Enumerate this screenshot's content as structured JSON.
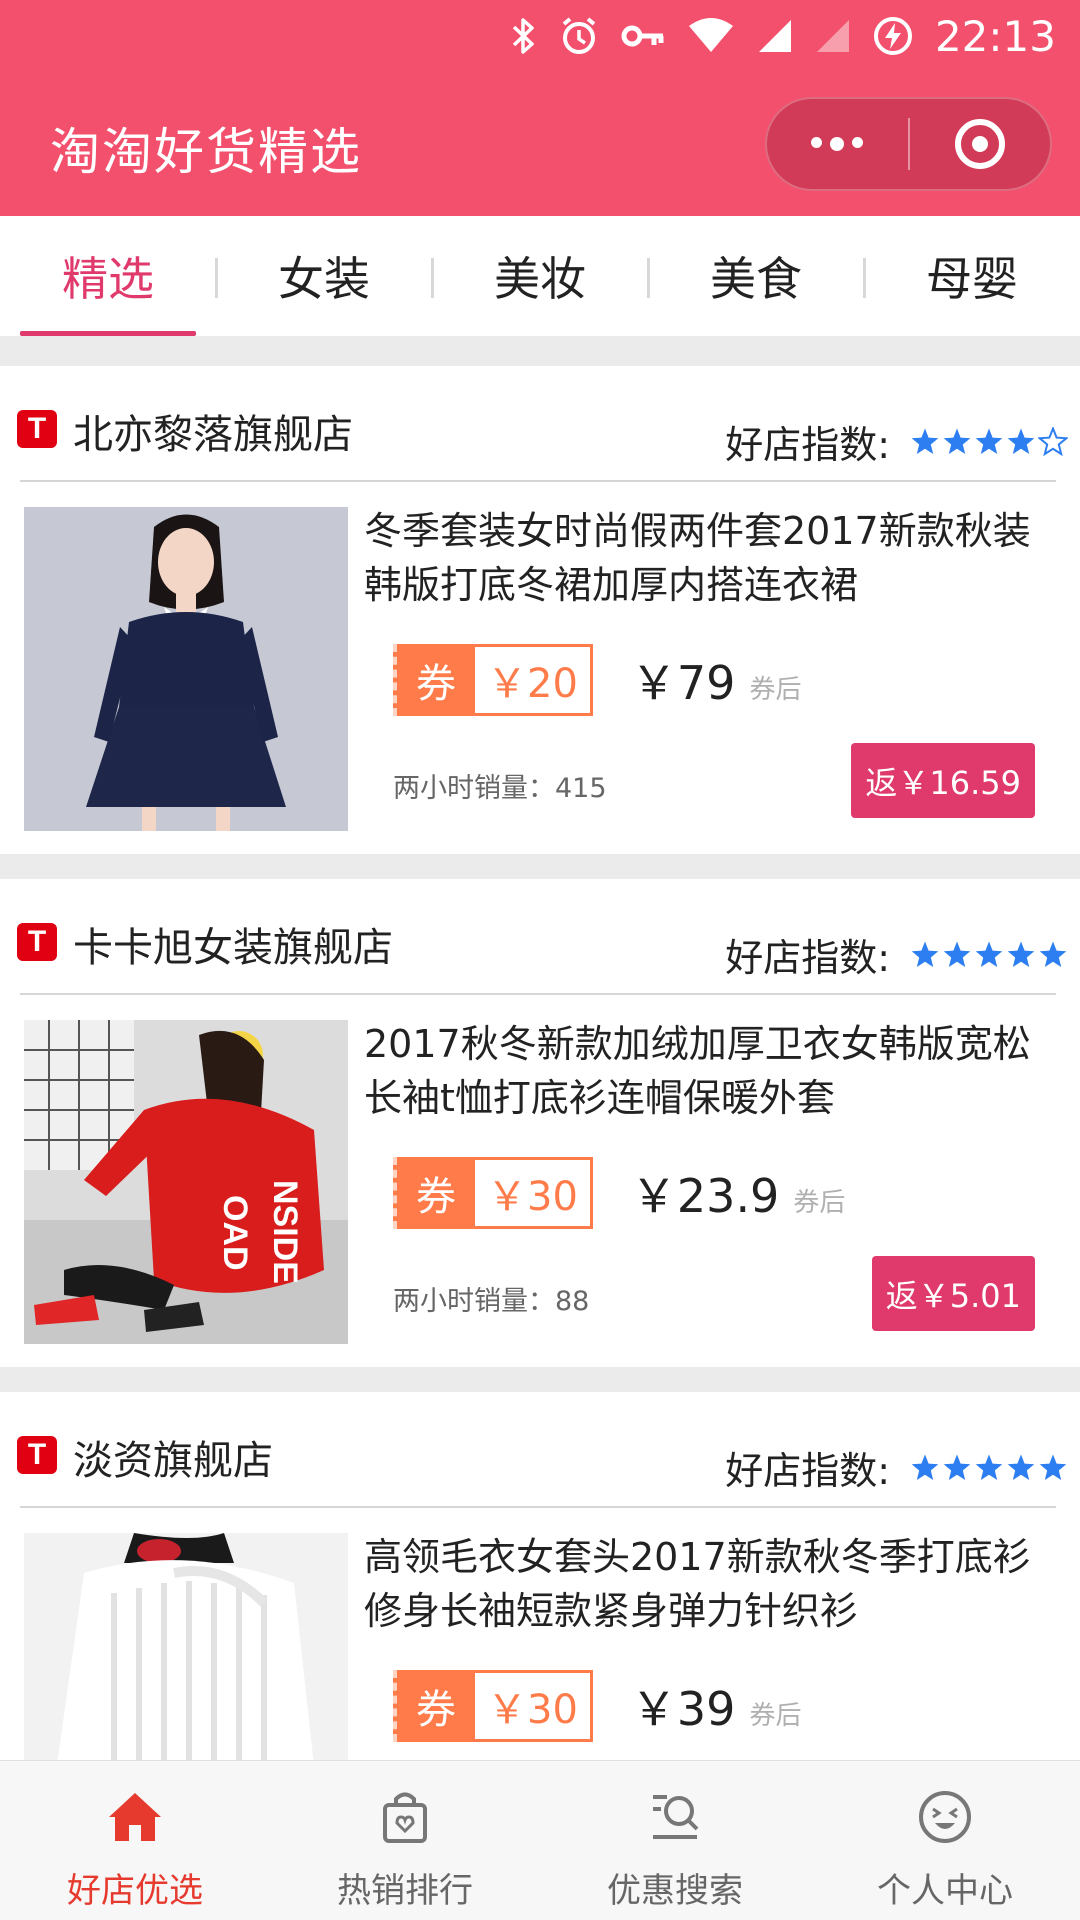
{
  "status_bar": {
    "time": "22:13",
    "icons": [
      "bluetooth-icon",
      "alarm-icon",
      "vpn-key-icon",
      "wifi-icon",
      "signal-icon",
      "signal-weak-icon",
      "battery-charging-icon"
    ]
  },
  "header": {
    "title": "淘淘好货精选",
    "capsule": [
      "more-icon",
      "close-target-icon"
    ],
    "background": "#f2506c"
  },
  "tabs": [
    {
      "label": "精选",
      "active": true
    },
    {
      "label": "女装",
      "active": false
    },
    {
      "label": "美妆",
      "active": false
    },
    {
      "label": "美食",
      "active": false
    },
    {
      "label": "母婴",
      "active": false
    }
  ],
  "cards": [
    {
      "shop_name": "北亦黎落旗舰店",
      "score_label": "好店指数:",
      "rating": 4,
      "title": "冬季套装女时尚假两件套2017新款秋装韩版打底冬裙加厚内搭连衣裙",
      "coupon_tag": "券",
      "coupon_amount": "￥20",
      "price": "￥79",
      "after_label": "券后",
      "sales": "两小时销量：415",
      "rebate": "返￥16.59",
      "image": "navy-dress-photo"
    },
    {
      "shop_name": "卡卡旭女装旗舰店",
      "score_label": "好店指数:",
      "rating": 5,
      "title": "2017秋冬新款加绒加厚卫衣女韩版宽松长袖t恤打底衫连帽保暖外套",
      "coupon_tag": "券",
      "coupon_amount": "￥30",
      "price": "￥23.9",
      "after_label": "券后",
      "sales": "两小时销量：88",
      "rebate": "返￥5.01",
      "image": "red-hoodie-photo"
    },
    {
      "shop_name": "淡资旗舰店",
      "score_label": "好店指数:",
      "rating": 5,
      "title": "高领毛衣女套头2017新款秋冬季打底衫修身长袖短款紧身弹力针织衫",
      "coupon_tag": "券",
      "coupon_amount": "￥30",
      "price": "￥39",
      "after_label": "券后",
      "sales": "",
      "rebate": "",
      "image": "white-sweater-photo"
    }
  ],
  "bottom_nav": [
    {
      "label": "好店优选",
      "icon": "home-icon",
      "active": true
    },
    {
      "label": "热销排行",
      "icon": "shopping-bag-icon",
      "active": false
    },
    {
      "label": "优惠搜索",
      "icon": "search-list-icon",
      "active": false
    },
    {
      "label": "个人中心",
      "icon": "smiley-icon",
      "active": false
    }
  ],
  "colors": {
    "accent": "#e0396b",
    "coupon": "#ff7c4a",
    "star": "#2d7ef0",
    "nav_active": "#e63a2e"
  }
}
